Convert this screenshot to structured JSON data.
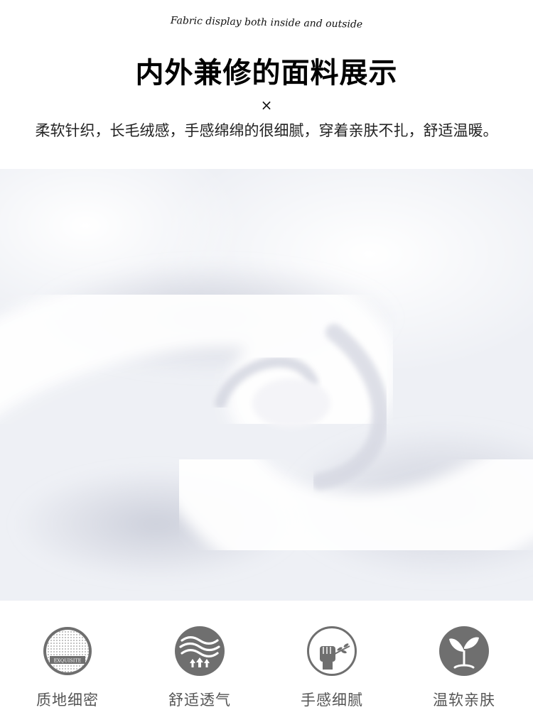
{
  "header": {
    "subtitle_en": "Fabric display both inside and outside",
    "title_cn": "内外兼修的面料展示",
    "times_mark": "×",
    "description_cn": "柔软针织，长毛绒感，手感绵绵的很细腻，穿着亲肤不扎，舒适温暖。"
  },
  "photo": {
    "alt": "white plush fabric close-up"
  },
  "features": [
    {
      "label": "质地细密",
      "icon": "texture-circle-icon",
      "icon_text": "EXQUISITE"
    },
    {
      "label": "舒适透气",
      "icon": "breathable-waves-icon"
    },
    {
      "label": "手感细腻",
      "icon": "hand-feel-icon"
    },
    {
      "label": "温软亲肤",
      "icon": "sprout-leaf-icon"
    }
  ],
  "colors": {
    "icon_gray": "#6f6f6f",
    "label_gray": "#555555"
  }
}
